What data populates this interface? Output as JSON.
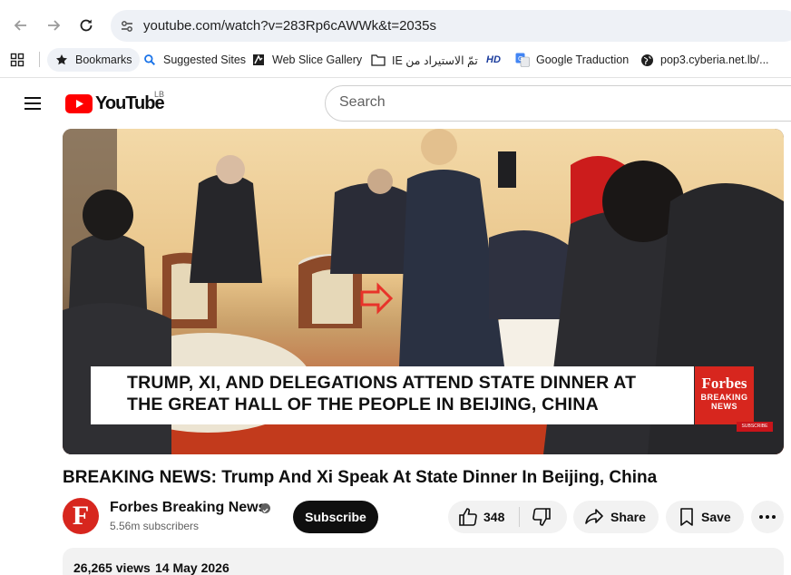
{
  "browser": {
    "url": "youtube.com/watch?v=283Rp6cAWWk&t=2035s",
    "icons": {
      "back": "arrow-left-icon",
      "forward": "arrow-right-icon",
      "reload": "reload-icon",
      "site_info": "tune-icon"
    }
  },
  "bookmarks": {
    "items": [
      {
        "label": "Bookmarks",
        "icon": "star-icon"
      },
      {
        "label": "Suggested Sites",
        "icon": "search-icon"
      },
      {
        "label": "Web Slice Gallery",
        "icon": "webslice-icon"
      },
      {
        "label": "IE تمّ الاستيراد من",
        "icon": "folder-icon"
      },
      {
        "label": "",
        "icon": "hd-icon",
        "badge": "HD"
      },
      {
        "label": "Google Traduction",
        "icon": "translate-icon"
      },
      {
        "label": "pop3.cyberia.net.lb/...",
        "icon": "globe-icon"
      }
    ]
  },
  "youtube": {
    "logo_text": "YouTube",
    "region": "LB",
    "search_placeholder": "Search"
  },
  "video": {
    "chyron_line1": "TRUMP, XI, AND DELEGATIONS ATTEND STATE DINNER AT",
    "chyron_line2": "THE GREAT HALL OF THE PEOPLE IN BEIJING, CHINA",
    "brand_name": "Forbes",
    "brand_sub1": "BREAKING",
    "brand_sub2": "NEWS",
    "subscribe_tag": "SUBSCRIBE"
  },
  "meta": {
    "title": "BREAKING NEWS: Trump And Xi Speak At State Dinner In Beijing, China",
    "channel_initial": "F",
    "channel_name": "Forbes Breaking News",
    "subscribers": "5.56m subscribers",
    "subscribe_label": "Subscribe",
    "likes": "348",
    "share_label": "Share",
    "save_label": "Save",
    "views": "26,265 views",
    "date": "14 May 2026"
  },
  "colors": {
    "yt_red": "#ff0000",
    "forbes_red": "#d7261e",
    "pill_bg": "#f2f2f2",
    "omnibox_bg": "#eef1f6"
  }
}
